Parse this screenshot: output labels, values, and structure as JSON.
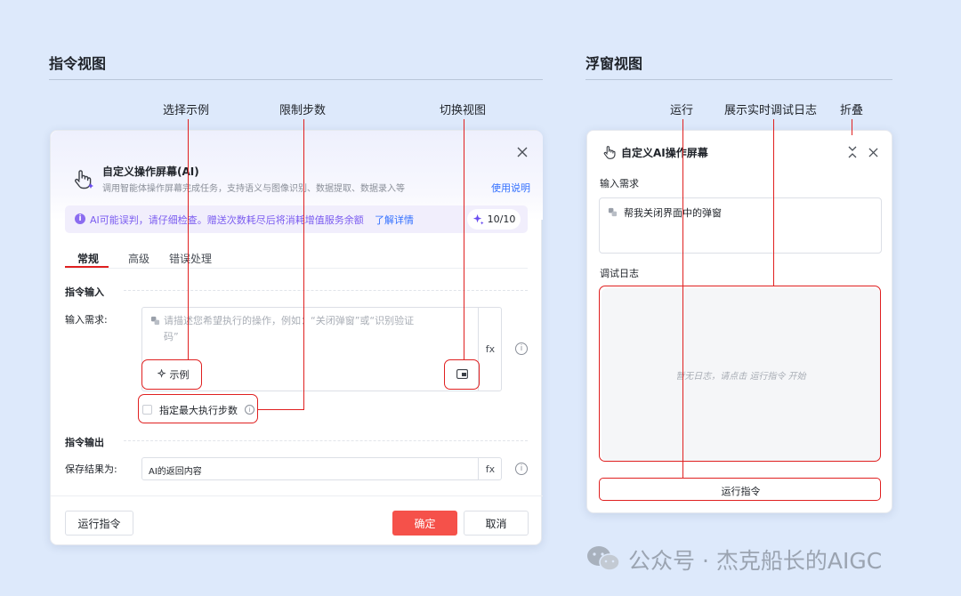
{
  "sections": {
    "left_title": "指令视图",
    "right_title": "浮窗视图"
  },
  "annotations": {
    "select_example": "选择示例",
    "limit_steps": "限制步数",
    "switch_view": "切换视图",
    "run": "运行",
    "live_log": "展示实时调试日志",
    "collapse": "折叠"
  },
  "command_dialog": {
    "title": "自定义操作屏幕(AI)",
    "description": "调用智能体操作屏幕完成任务，支持语义与图像识别、数据提取、数据录入等",
    "help_link": "使用说明",
    "notice_text": "AI可能误判，请仔细检查。赠送次数耗尽后将消耗增值服务余额",
    "notice_link": "了解详情",
    "quota": "10/10",
    "tabs": [
      "常规",
      "高级",
      "错误处理"
    ],
    "input_section": "指令输入",
    "input_label": "输入需求:",
    "input_placeholder_line1": "请描述您希望执行的操作，例如：“关闭弹窗”或“识别验证",
    "input_placeholder_line2": "码”",
    "fx": "fx",
    "example_button": "示例",
    "max_steps_label": "指定最大执行步数",
    "output_section": "指令输出",
    "save_label": "保存结果为:",
    "save_value": "AI的返回内容",
    "run_button": "运行指令",
    "confirm_button": "确定",
    "cancel_button": "取消"
  },
  "float_dialog": {
    "title": "自定义AI操作屏幕",
    "input_label": "输入需求",
    "input_value": "帮我关闭界面中的弹窗",
    "log_label": "调试日志",
    "log_empty": "暂无日志，请点击 运行指令 开始",
    "run_button": "运行指令"
  },
  "watermark": "公众号 · 杰克船长的AIGC",
  "colors": {
    "background": "#dde9fb",
    "accent_red": "#e02020",
    "primary_button": "#f5514a",
    "link_blue": "#3370ff",
    "notice_bg": "#f1eefc",
    "notice_icon": "#8b6cf0"
  }
}
